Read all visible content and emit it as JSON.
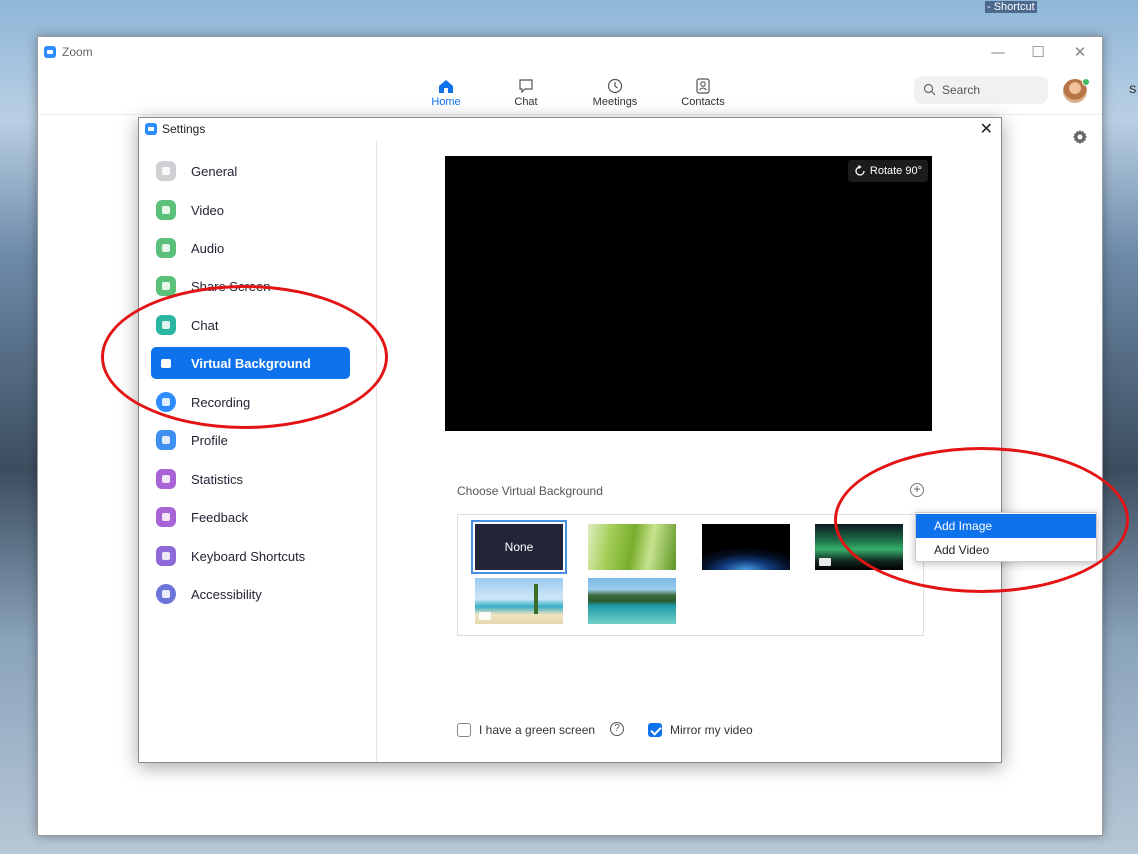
{
  "desktop": {
    "shortcut_label": "- Shortcut",
    "clipped_text": "S"
  },
  "window": {
    "title": "Zoom",
    "minimize": "—",
    "maximize": "☐",
    "close": "✕"
  },
  "nav": {
    "tabs": [
      {
        "label": "Home",
        "active": true
      },
      {
        "label": "Chat"
      },
      {
        "label": "Meetings"
      },
      {
        "label": "Contacts"
      }
    ],
    "search_label": "Search"
  },
  "settings": {
    "title": "Settings",
    "close": "✕",
    "sidebar": [
      {
        "label": "General",
        "color": "#d0d0d4"
      },
      {
        "label": "Video",
        "color": "#5bc17a"
      },
      {
        "label": "Audio",
        "color": "#5bc17a"
      },
      {
        "label": "Share Screen",
        "color": "#5bc17a"
      },
      {
        "label": "Chat",
        "color": "#2ab5a0"
      },
      {
        "label": "Virtual Background",
        "color": "#0e72ed",
        "active": true
      },
      {
        "label": "Recording",
        "color": "#2d8cff"
      },
      {
        "label": "Profile",
        "color": "#3f8ff0"
      },
      {
        "label": "Statistics",
        "color": "#a863d6"
      },
      {
        "label": "Feedback",
        "color": "#a863d6"
      },
      {
        "label": "Keyboard Shortcuts",
        "color": "#8e6ad8"
      },
      {
        "label": "Accessibility",
        "color": "#6b74d9"
      }
    ],
    "preview": {
      "rotate_label": "Rotate 90°"
    },
    "choose_label": "Choose Virtual Background",
    "add_symbol": "+",
    "backgrounds": {
      "none_label": "None"
    },
    "dropdown": [
      {
        "label": "Add Image",
        "highlighted": true
      },
      {
        "label": "Add Video"
      }
    ],
    "green_screen_label": "I have a green screen",
    "green_screen_checked": false,
    "help_symbol": "?",
    "mirror_label": "Mirror my video",
    "mirror_checked": true
  },
  "colors": {
    "accent": "#0e72ed",
    "annotation": "#e21414"
  }
}
